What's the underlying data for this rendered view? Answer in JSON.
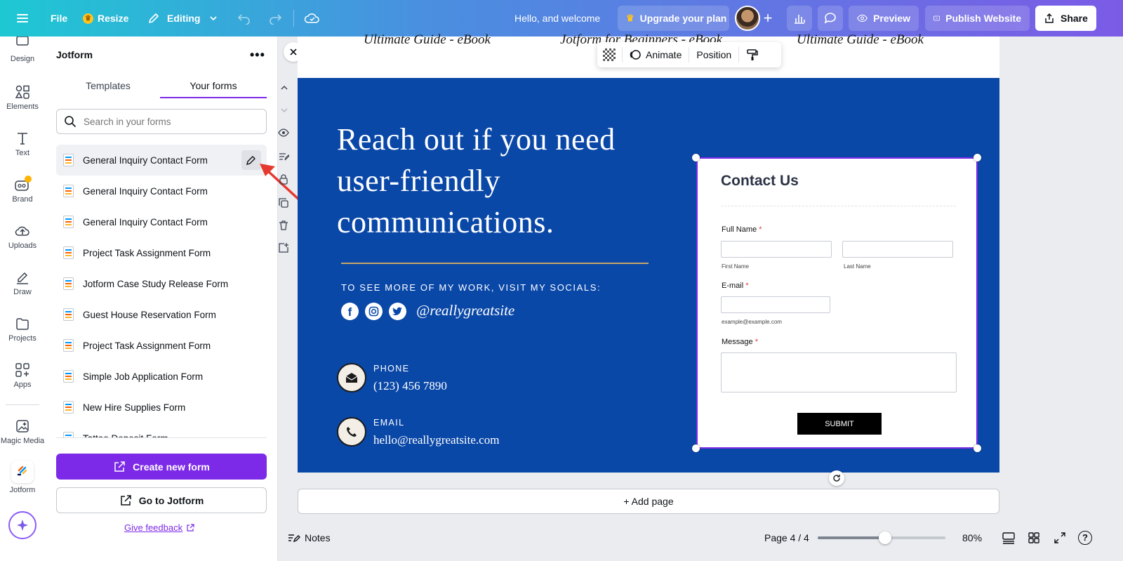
{
  "topbar": {
    "file": "File",
    "resize": "Resize",
    "editing": "Editing",
    "greeting": "Hello, and welcome",
    "upgrade": "Upgrade your plan",
    "preview": "Preview",
    "publish": "Publish Website",
    "share": "Share"
  },
  "rail": {
    "items": [
      {
        "label": "Design",
        "icon": "design-icon"
      },
      {
        "label": "Elements",
        "icon": "elements-icon"
      },
      {
        "label": "Text",
        "icon": "text-icon"
      },
      {
        "label": "Brand",
        "icon": "brand-icon"
      },
      {
        "label": "Uploads",
        "icon": "uploads-icon"
      },
      {
        "label": "Draw",
        "icon": "draw-icon"
      },
      {
        "label": "Projects",
        "icon": "projects-icon"
      },
      {
        "label": "Apps",
        "icon": "apps-icon"
      },
      {
        "label": "Magic Media",
        "icon": "magic-media-icon"
      },
      {
        "label": "Jotform",
        "icon": "jotform-icon"
      }
    ]
  },
  "panel": {
    "title": "Jotform",
    "tabs": [
      "Templates",
      "Your forms"
    ],
    "search_placeholder": "Search in your forms",
    "forms": [
      "General Inquiry Contact Form",
      "General Inquiry Contact Form",
      "General Inquiry Contact Form",
      "Project Task Assignment Form",
      "Jotform Case Study Release Form",
      "Guest House Reservation Form",
      "Project Task Assignment Form",
      "Simple Job Application Form",
      "New Hire Supplies Form",
      "Tattoo Deposit Form"
    ],
    "create": "Create new form",
    "goto": "Go to Jotform",
    "feedback": "Give feedback"
  },
  "canvas": {
    "ebooks": [
      "Ultimate Guide - eBook",
      "Jotform for Beginners - eBook",
      "Ultimate Guide - eBook"
    ],
    "toolbar": {
      "animate": "Animate",
      "position": "Position"
    },
    "headline_lines": [
      "Reach out if you need",
      "user-friendly",
      "communications."
    ],
    "socials_caption": "TO SEE MORE OF MY WORK, VISIT MY SOCIALS:",
    "handle": "@reallygreatsite",
    "phone_label": "PHONE",
    "phone_value": "(123) 456 7890",
    "email_label": "EMAIL",
    "email_value": "hello@reallygreatsite.com"
  },
  "form": {
    "title": "Contact Us",
    "full_name": "Full Name",
    "first_name": "First Name",
    "last_name": "Last Name",
    "email": "E-mail",
    "email_hint": "example@example.com",
    "message": "Message",
    "required_mark": "*",
    "submit": "SUBMIT"
  },
  "footer": {
    "add_page": "+ Add page",
    "notes": "Notes",
    "page": "Page 4 / 4",
    "zoom": "80%",
    "zoom_level": 0.8
  },
  "colors": {
    "accent": "#7d2ae8",
    "cta_bg": "#0a48a8",
    "topbar_start": "#1ec8d3",
    "topbar_end": "#7b5be6"
  }
}
